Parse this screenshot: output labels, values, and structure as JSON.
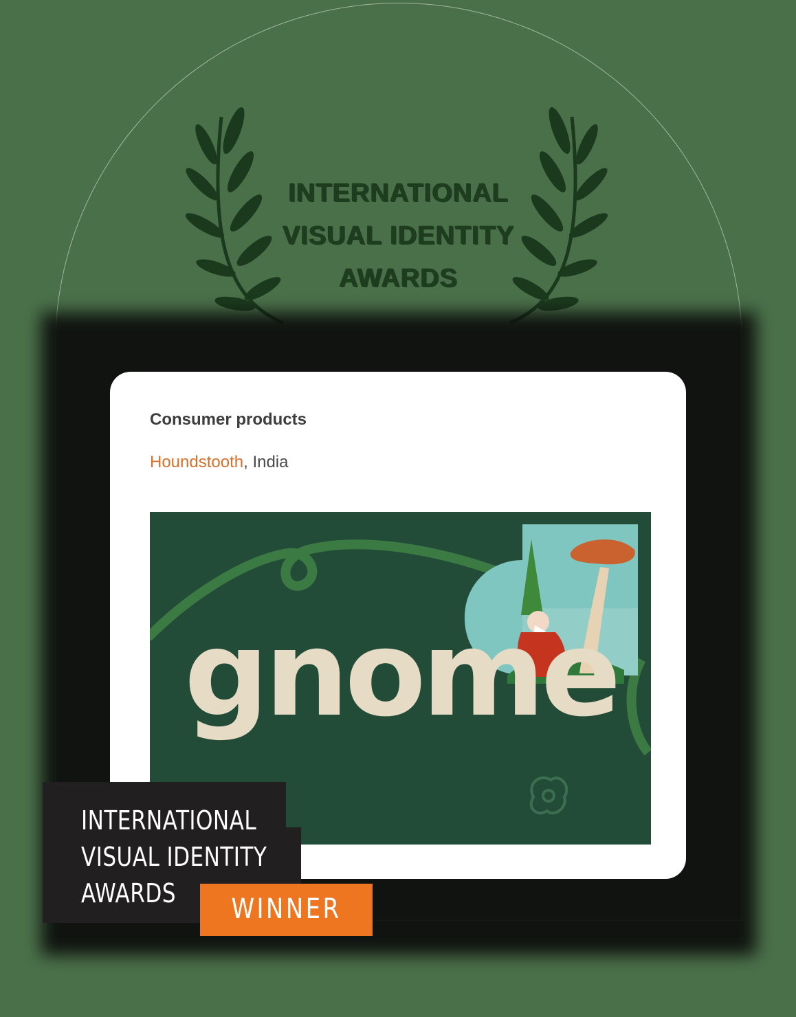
{
  "award": {
    "laurel_lines": [
      "INTERNATIONAL",
      "VISUAL IDENTITY",
      "AWARDS"
    ],
    "laurel_icon": "laurel-wreath-icon"
  },
  "card": {
    "category": "Consumer products",
    "studio": "Houndstooth",
    "location_suffix": ", India",
    "brand_image": {
      "wordmark": "gnome",
      "mark_icon": "gnome-logo-mark-icon",
      "colors": {
        "background": "#234c38",
        "wordmark": "#e6dbc4",
        "swirl": "#3c7a44"
      }
    }
  },
  "badge": {
    "lines": [
      "INTERNATIONAL",
      "VISUAL IDENTITY",
      "AWARDS"
    ],
    "status": "WINNER",
    "colors": {
      "dark": "#211f20",
      "accent": "#ee7621"
    }
  },
  "colors": {
    "page_background": "#4a7049",
    "studio_link": "#d9702a"
  }
}
